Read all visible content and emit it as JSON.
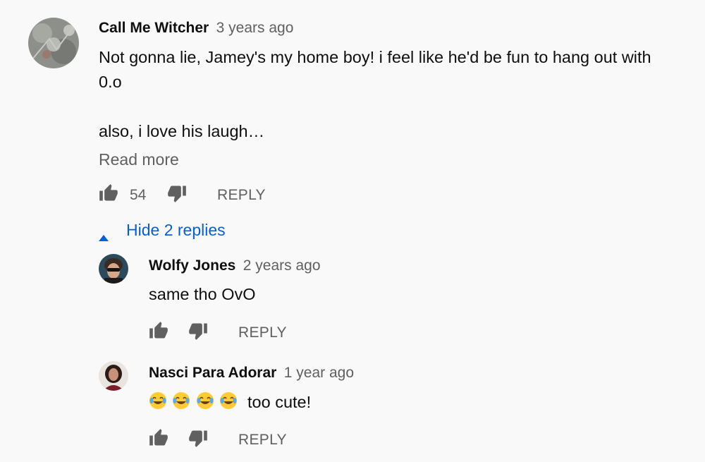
{
  "comment": {
    "author": "Call Me Witcher",
    "time": "3 years ago",
    "text": "Not gonna lie, Jamey's my home boy! i feel like he'd be fun to hang out with\n0.o\n\nalso, i love his laugh…",
    "read_more": "Read more",
    "likes": "54",
    "reply_label": "REPLY"
  },
  "replies_toggle": {
    "label": "Hide 2 replies"
  },
  "replies": [
    {
      "author": "Wolfy Jones",
      "time": "2 years ago",
      "text": "same tho OvO",
      "reply_label": "REPLY"
    },
    {
      "author": "Nasci Para Adorar",
      "time": "1 year ago",
      "emojis": [
        "😂",
        "😂",
        "😂",
        "😂"
      ],
      "text": "too cute!",
      "reply_label": "REPLY"
    }
  ],
  "icons": {
    "like": "thumbs-up-icon",
    "dislike": "thumbs-down-icon",
    "caret": "caret-up-icon",
    "emoji": "tears-of-joy-emoji"
  },
  "colors": {
    "link": "#065fd4",
    "secondary": "#606060",
    "background": "#f9f9f9"
  }
}
